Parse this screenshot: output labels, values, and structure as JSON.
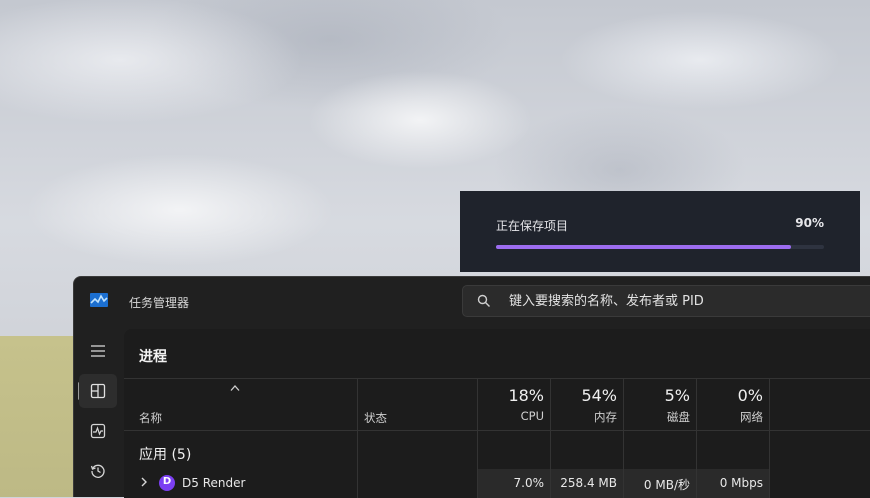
{
  "toast": {
    "title": "正在保存项目",
    "percent_label": "90%",
    "progress": 0.9,
    "accent_color": "#9c6cf0"
  },
  "window": {
    "title": "任务管理器",
    "app_icon": "task-manager-icon",
    "search": {
      "placeholder": "键入要搜索的名称、发布者或 PID",
      "value": ""
    },
    "nav": [
      {
        "icon": "hamburger-menu-icon"
      },
      {
        "icon": "processes-icon",
        "active": true
      },
      {
        "icon": "performance-icon"
      },
      {
        "icon": "app-history-icon"
      }
    ],
    "page_title": "进程",
    "columns": {
      "name": "名称",
      "status": "状态",
      "cpu": {
        "percent": "18%",
        "label": "CPU"
      },
      "memory": {
        "percent": "54%",
        "label": "内存"
      },
      "disk": {
        "percent": "5%",
        "label": "磁盘"
      },
      "network": {
        "percent": "0%",
        "label": "网络"
      }
    },
    "group": {
      "title": "应用 (5)"
    },
    "rows": [
      {
        "name": "D5 Render",
        "icon_letter": "D",
        "status": "",
        "cpu": "7.0%",
        "memory": "258.4 MB",
        "disk": "0 MB/秒",
        "network": "0 Mbps"
      }
    ]
  }
}
